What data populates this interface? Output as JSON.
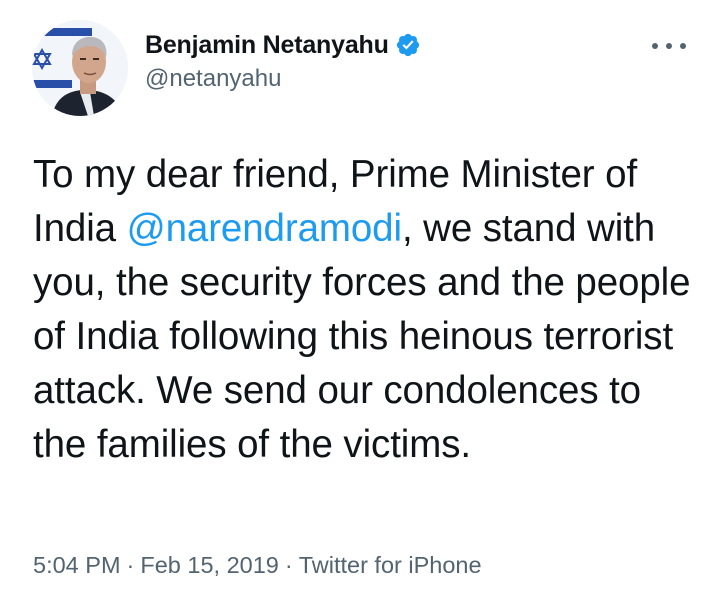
{
  "author": {
    "display_name": "Benjamin Netanyahu",
    "handle": "@netanyahu",
    "verified": true,
    "avatar_icon": "profile-photo"
  },
  "tweet": {
    "text_before_mention": "To my dear friend, Prime Minister of India ",
    "mention": "@narendramodi",
    "text_after_mention": ", we stand with you, the security forces and the people of India following this heinous terrorist attack. We send our condolences to the families of the victims."
  },
  "meta": {
    "time": "5:04 PM",
    "separator": "·",
    "date": "Feb 15, 2019",
    "source": "Twitter for iPhone"
  },
  "colors": {
    "text": "#0f1419",
    "secondary": "#536471",
    "accent": "#1d9bf0"
  },
  "icons": {
    "verified": "verified-badge-icon",
    "more": "more-options-icon"
  }
}
